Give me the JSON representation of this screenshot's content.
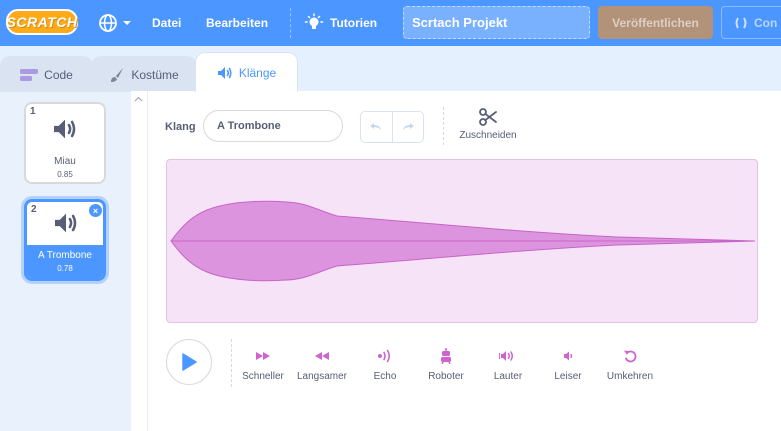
{
  "menubar": {
    "logo_text": "SCRATCH",
    "file_label": "Datei",
    "edit_label": "Bearbeiten",
    "tutorials_label": "Tutorien",
    "project_title": "Scrtach Projekt",
    "publish_label": "Veröffentlichen",
    "remix_label": "Con"
  },
  "tabs": {
    "code_label": "Code",
    "costumes_label": "Kostüme",
    "sounds_label": "Klänge"
  },
  "sounds": [
    {
      "index": "1",
      "name": "Miau",
      "duration": "0.85"
    },
    {
      "index": "2",
      "name": "A Trombone",
      "duration": "0.78"
    }
  ],
  "editor": {
    "sound_label": "Klang",
    "sound_name": "A Trombone",
    "trim_label": "Zuschneiden"
  },
  "effects": {
    "faster": "Schneller",
    "slower": "Langsamer",
    "echo": "Echo",
    "robot": "Roboter",
    "louder": "Lauter",
    "softer": "Leiser",
    "reverse": "Umkehren"
  },
  "colors": {
    "menubar": "#4c97ff",
    "accent": "#4c97ff",
    "effect_icon": "#cf63cf",
    "waveform_fill": "#dc94de",
    "waveform_bg": "#f6e3f7"
  }
}
